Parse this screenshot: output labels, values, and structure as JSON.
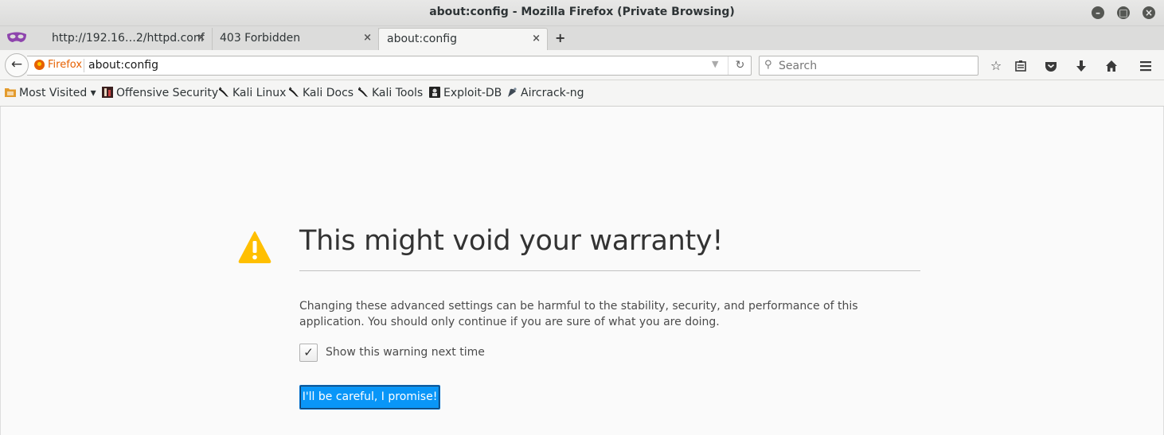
{
  "window": {
    "title": "about:config - Mozilla Firefox (Private Browsing)"
  },
  "tabs": [
    {
      "label": "http://192.16…2/httpd.conf",
      "active": false
    },
    {
      "label": "403 Forbidden",
      "active": false
    },
    {
      "label": "about:config",
      "active": true
    }
  ],
  "tab_close_glyph": "×",
  "newtab_glyph": "+",
  "navbar": {
    "identity_label": "Firefox",
    "url": "about:config",
    "search_placeholder": "Search"
  },
  "bookmarks": [
    {
      "label": "Most Visited ▾",
      "icon": "folder-icon"
    },
    {
      "label": "Offensive Security",
      "icon": "offsec-icon"
    },
    {
      "label": "Kali Linux",
      "icon": "kali-icon"
    },
    {
      "label": "Kali Docs",
      "icon": "kali-icon"
    },
    {
      "label": "Kali Tools",
      "icon": "kali-icon"
    },
    {
      "label": "Exploit-DB",
      "icon": "exploitdb-icon"
    },
    {
      "label": "Aircrack-ng",
      "icon": "aircrack-icon"
    }
  ],
  "page": {
    "heading": "This might void your warranty!",
    "description": "Changing these advanced settings can be harmful to the stability, security, and performance of this application. You should only continue if you are sure of what you are doing.",
    "checkbox_label": "Show this warning next time",
    "checkbox_checked": true,
    "button_label": "I'll be careful, I promise!"
  },
  "colors": {
    "accent_button": "#0996f8",
    "warning_icon": "#ffbf00",
    "firefox_orange": "#e66000"
  }
}
